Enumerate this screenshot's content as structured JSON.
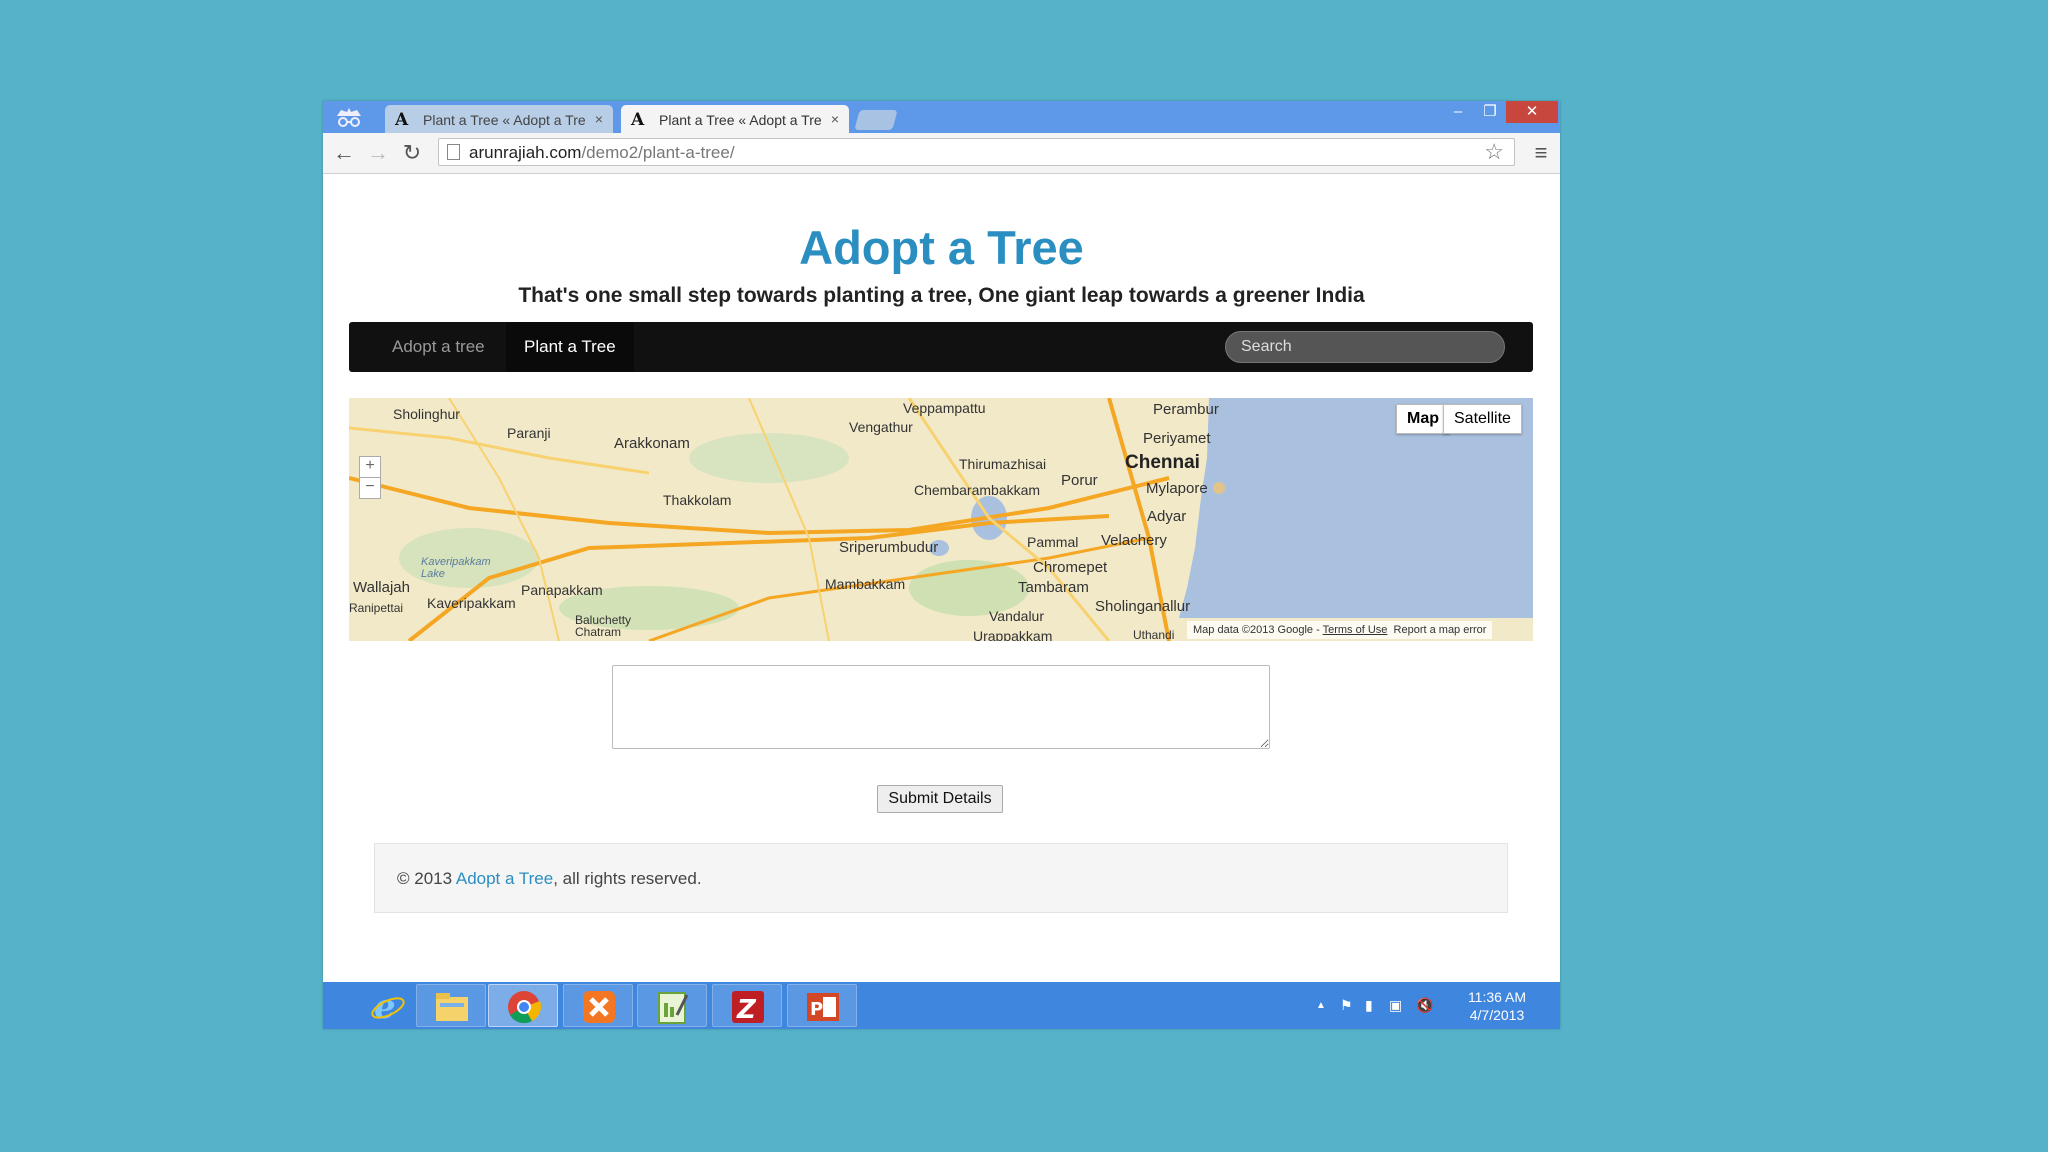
{
  "browser": {
    "tabs": [
      {
        "label": "Plant a Tree « Adopt a Tre",
        "favicon": "A",
        "close": "×",
        "state": "inactive"
      },
      {
        "label": "Plant a Tree « Adopt a Tre",
        "favicon": "A",
        "close": "×",
        "state": "active"
      }
    ],
    "address": {
      "domain": "arunrajiah.com",
      "path": "/demo2/plant-a-tree/"
    },
    "icons": {
      "back": "back-arrow-icon",
      "forward": "forward-arrow-icon",
      "reload": "reload-icon",
      "bookmark": "star-icon",
      "menu": "hamburger-menu-icon",
      "incognito": "incognito-icon"
    }
  },
  "site": {
    "title": "Adopt a Tree",
    "tagline": "That's one small step towards planting a tree, One giant leap towards a greener India",
    "accent_color": "#2a8ec0",
    "nav": {
      "items": [
        {
          "label": "Adopt a tree",
          "active": false
        },
        {
          "label": "Plant a Tree",
          "active": true
        }
      ],
      "search_placeholder": "Search"
    }
  },
  "map": {
    "type_buttons": [
      {
        "label": "Map",
        "selected": true
      },
      {
        "label": "Satellite",
        "selected": false
      }
    ],
    "zoom_in": "+",
    "zoom_out": "−",
    "places": [
      "Sholinghur",
      "Paranji",
      "Arakkonam",
      "Vengathur",
      "Veppampattu",
      "Perambur",
      "Periyamet",
      "Chennai",
      "Thirumazhisai",
      "Chembarambakkam",
      "Porur",
      "Mylapore",
      "Thakkolam",
      "Adyar",
      "Sriperumbudur",
      "Pammal",
      "Velachery",
      "Kaveripakkam Lake",
      "Chromepet",
      "Wallajah",
      "Panapakkam",
      "Mambakkam",
      "Tambaram",
      "Kaveripakkam",
      "Sholinganallur",
      "Vandalur",
      "Baluchetty Chatram",
      "Urappakkam",
      "Uthandi",
      "Ranipettai"
    ],
    "attribution": "Map data ©2013 Google",
    "terms": "Terms of Use",
    "report": "Report a map error"
  },
  "form": {
    "textarea_value": "",
    "submit_label": "Submit Details"
  },
  "footer": {
    "prefix": "© 2013 ",
    "link": "Adopt a Tree",
    "suffix": ", all rights reserved."
  },
  "taskbar": {
    "apps": [
      "internet-explorer-icon",
      "file-explorer-icon",
      "chrome-icon",
      "xampp-icon",
      "notepad-plus-plus-icon",
      "filezilla-icon",
      "powerpoint-icon"
    ],
    "time": "11:36 AM",
    "date": "4/7/2013"
  }
}
